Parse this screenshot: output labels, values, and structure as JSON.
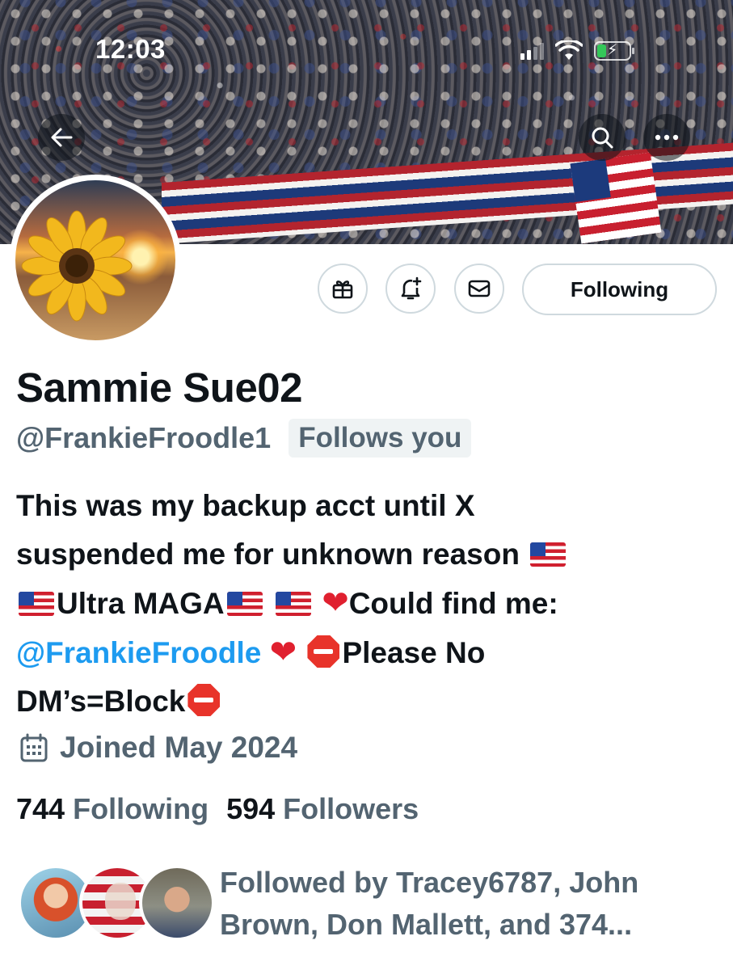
{
  "status_bar": {
    "time": "12:03",
    "signal_bars_active": 2,
    "signal_bars_total": 4,
    "battery_charging": true,
    "battery_color": "#34c759"
  },
  "header": {
    "back_icon": "arrow-left-icon",
    "search_icon": "search-icon",
    "more_icon": "more-horizontal-icon"
  },
  "actions": {
    "gift_icon": "gift-icon",
    "notify_icon": "bell-plus-icon",
    "message_icon": "envelope-icon",
    "follow_label": "Following"
  },
  "profile": {
    "display_name": "Sammie Sue02",
    "handle": "@FrankieFroodle1",
    "follows_you": "Follows you",
    "bio": {
      "line1": "This was my backup acct until X",
      "line2": "suspended me for unknown reason",
      "line3_a": "Ultra MAGA",
      "line3_b": "Could find me:",
      "mention": "@FrankieFroodle",
      "line4_b": "Please No",
      "line5": "DM’s=Block"
    },
    "joined": "Joined May 2024"
  },
  "stats": {
    "following_count": "744",
    "following_label": "Following",
    "followers_count": "594",
    "followers_label": "Followers"
  },
  "followed_by": {
    "text": "Followed by Tracey6787, John Brown, Don Mallett, and 374..."
  },
  "colors": {
    "text_primary": "#0f1419",
    "text_secondary": "#536471",
    "link": "#1d9bf0",
    "border": "#cfd9de"
  }
}
